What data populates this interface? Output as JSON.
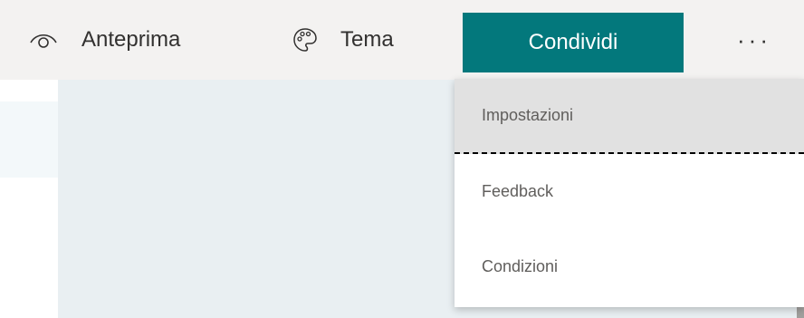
{
  "toolbar": {
    "preview": {
      "label": "Anteprima",
      "icon": "eye-icon"
    },
    "theme": {
      "label": "Tema",
      "icon": "palette-icon"
    },
    "share": {
      "label": "Condividi",
      "color": "#03787c"
    },
    "more": {
      "label": "···",
      "icon": "more-options-icon"
    }
  },
  "menu": {
    "items": [
      {
        "label": "Impostazioni",
        "selected": true
      },
      {
        "label": "Feedback",
        "selected": false
      },
      {
        "label": "Condizioni",
        "selected": false
      }
    ]
  },
  "colors": {
    "toolbar_bg": "#f3f2f1",
    "canvas_bg": "#e9eff2",
    "accent": "#03787c"
  }
}
